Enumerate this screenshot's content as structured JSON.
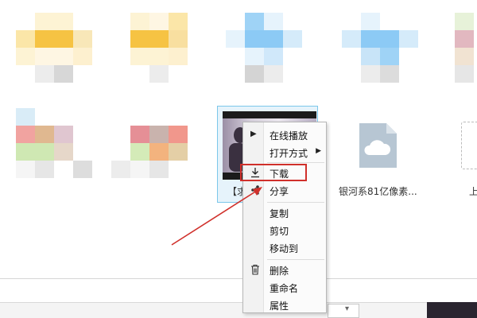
{
  "menu": {
    "items": [
      {
        "label": "在线播放",
        "icon": "play-triangle-icon",
        "submenu": false
      },
      {
        "label": "打开方式",
        "icon": "",
        "submenu": true
      },
      {
        "label": "下载",
        "icon": "download-icon",
        "submenu": false,
        "highlighted": true
      },
      {
        "label": "分享",
        "icon": "share-icon",
        "submenu": false
      },
      {
        "label": "复制",
        "icon": "",
        "submenu": false
      },
      {
        "label": "剪切",
        "icon": "",
        "submenu": false
      },
      {
        "label": "移动到",
        "icon": "",
        "submenu": false
      },
      {
        "label": "删除",
        "icon": "trash-icon",
        "submenu": false
      },
      {
        "label": "重命名",
        "icon": "",
        "submenu": false
      },
      {
        "label": "属性",
        "icon": "",
        "submenu": false
      }
    ]
  },
  "files": {
    "selected_video_label": "【求",
    "cloud_file_name": "银河系81亿像素...",
    "edge_file_label": "上"
  },
  "colors": {
    "selection_border": "#7cc7ea",
    "selection_fill": "#e6f3fb",
    "annotation_red": "#d0302b",
    "cloud_icon": "#b7c6d3"
  },
  "icons": {
    "submenu_arrow": "▶",
    "play": "▶",
    "dropdown": "▾"
  }
}
